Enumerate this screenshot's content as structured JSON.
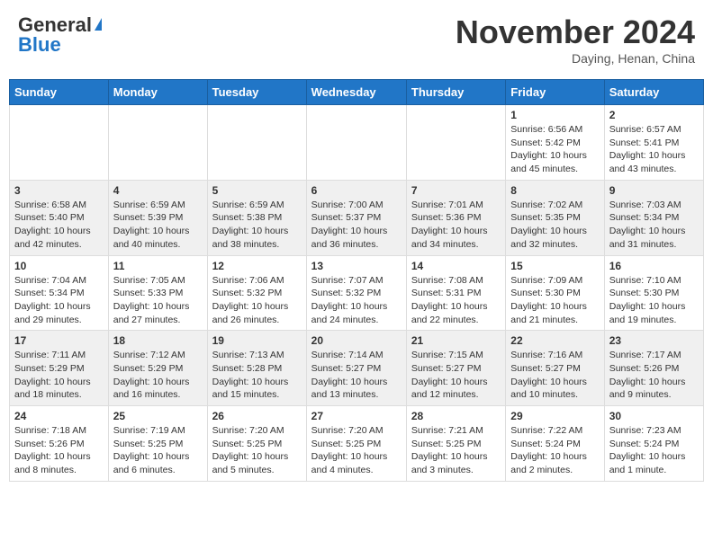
{
  "header": {
    "logo_general": "General",
    "logo_blue": "Blue",
    "month_title": "November 2024",
    "subtitle": "Daying, Henan, China"
  },
  "days_of_week": [
    "Sunday",
    "Monday",
    "Tuesday",
    "Wednesday",
    "Thursday",
    "Friday",
    "Saturday"
  ],
  "weeks": [
    [
      {
        "day": "",
        "info": ""
      },
      {
        "day": "",
        "info": ""
      },
      {
        "day": "",
        "info": ""
      },
      {
        "day": "",
        "info": ""
      },
      {
        "day": "",
        "info": ""
      },
      {
        "day": "1",
        "info": "Sunrise: 6:56 AM\nSunset: 5:42 PM\nDaylight: 10 hours and 45 minutes."
      },
      {
        "day": "2",
        "info": "Sunrise: 6:57 AM\nSunset: 5:41 PM\nDaylight: 10 hours and 43 minutes."
      }
    ],
    [
      {
        "day": "3",
        "info": "Sunrise: 6:58 AM\nSunset: 5:40 PM\nDaylight: 10 hours and 42 minutes."
      },
      {
        "day": "4",
        "info": "Sunrise: 6:59 AM\nSunset: 5:39 PM\nDaylight: 10 hours and 40 minutes."
      },
      {
        "day": "5",
        "info": "Sunrise: 6:59 AM\nSunset: 5:38 PM\nDaylight: 10 hours and 38 minutes."
      },
      {
        "day": "6",
        "info": "Sunrise: 7:00 AM\nSunset: 5:37 PM\nDaylight: 10 hours and 36 minutes."
      },
      {
        "day": "7",
        "info": "Sunrise: 7:01 AM\nSunset: 5:36 PM\nDaylight: 10 hours and 34 minutes."
      },
      {
        "day": "8",
        "info": "Sunrise: 7:02 AM\nSunset: 5:35 PM\nDaylight: 10 hours and 32 minutes."
      },
      {
        "day": "9",
        "info": "Sunrise: 7:03 AM\nSunset: 5:34 PM\nDaylight: 10 hours and 31 minutes."
      }
    ],
    [
      {
        "day": "10",
        "info": "Sunrise: 7:04 AM\nSunset: 5:34 PM\nDaylight: 10 hours and 29 minutes."
      },
      {
        "day": "11",
        "info": "Sunrise: 7:05 AM\nSunset: 5:33 PM\nDaylight: 10 hours and 27 minutes."
      },
      {
        "day": "12",
        "info": "Sunrise: 7:06 AM\nSunset: 5:32 PM\nDaylight: 10 hours and 26 minutes."
      },
      {
        "day": "13",
        "info": "Sunrise: 7:07 AM\nSunset: 5:32 PM\nDaylight: 10 hours and 24 minutes."
      },
      {
        "day": "14",
        "info": "Sunrise: 7:08 AM\nSunset: 5:31 PM\nDaylight: 10 hours and 22 minutes."
      },
      {
        "day": "15",
        "info": "Sunrise: 7:09 AM\nSunset: 5:30 PM\nDaylight: 10 hours and 21 minutes."
      },
      {
        "day": "16",
        "info": "Sunrise: 7:10 AM\nSunset: 5:30 PM\nDaylight: 10 hours and 19 minutes."
      }
    ],
    [
      {
        "day": "17",
        "info": "Sunrise: 7:11 AM\nSunset: 5:29 PM\nDaylight: 10 hours and 18 minutes."
      },
      {
        "day": "18",
        "info": "Sunrise: 7:12 AM\nSunset: 5:29 PM\nDaylight: 10 hours and 16 minutes."
      },
      {
        "day": "19",
        "info": "Sunrise: 7:13 AM\nSunset: 5:28 PM\nDaylight: 10 hours and 15 minutes."
      },
      {
        "day": "20",
        "info": "Sunrise: 7:14 AM\nSunset: 5:27 PM\nDaylight: 10 hours and 13 minutes."
      },
      {
        "day": "21",
        "info": "Sunrise: 7:15 AM\nSunset: 5:27 PM\nDaylight: 10 hours and 12 minutes."
      },
      {
        "day": "22",
        "info": "Sunrise: 7:16 AM\nSunset: 5:27 PM\nDaylight: 10 hours and 10 minutes."
      },
      {
        "day": "23",
        "info": "Sunrise: 7:17 AM\nSunset: 5:26 PM\nDaylight: 10 hours and 9 minutes."
      }
    ],
    [
      {
        "day": "24",
        "info": "Sunrise: 7:18 AM\nSunset: 5:26 PM\nDaylight: 10 hours and 8 minutes."
      },
      {
        "day": "25",
        "info": "Sunrise: 7:19 AM\nSunset: 5:25 PM\nDaylight: 10 hours and 6 minutes."
      },
      {
        "day": "26",
        "info": "Sunrise: 7:20 AM\nSunset: 5:25 PM\nDaylight: 10 hours and 5 minutes."
      },
      {
        "day": "27",
        "info": "Sunrise: 7:20 AM\nSunset: 5:25 PM\nDaylight: 10 hours and 4 minutes."
      },
      {
        "day": "28",
        "info": "Sunrise: 7:21 AM\nSunset: 5:25 PM\nDaylight: 10 hours and 3 minutes."
      },
      {
        "day": "29",
        "info": "Sunrise: 7:22 AM\nSunset: 5:24 PM\nDaylight: 10 hours and 2 minutes."
      },
      {
        "day": "30",
        "info": "Sunrise: 7:23 AM\nSunset: 5:24 PM\nDaylight: 10 hours and 1 minute."
      }
    ]
  ]
}
